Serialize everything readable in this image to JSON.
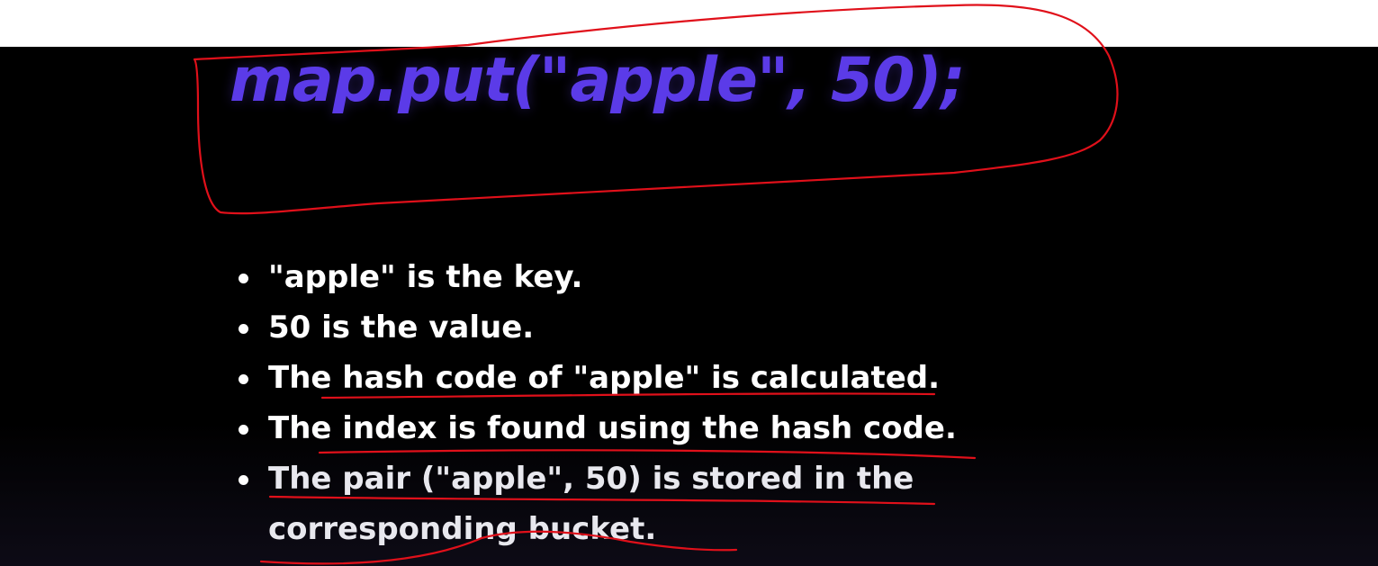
{
  "slide": {
    "code": "map.put(\"apple\", 50);",
    "bullets": [
      "\"apple\" is the key.",
      "50 is the value.",
      "The hash code of \"apple\" is calculated.",
      "The index is found using the hash code.",
      "The pair (\"apple\", 50) is stored in the corresponding bucket."
    ]
  },
  "colors": {
    "code_text": "#5b3be8",
    "slide_background": "#000000",
    "bullet_text": "#ffffff",
    "annotation_ink": "#e0101a"
  }
}
